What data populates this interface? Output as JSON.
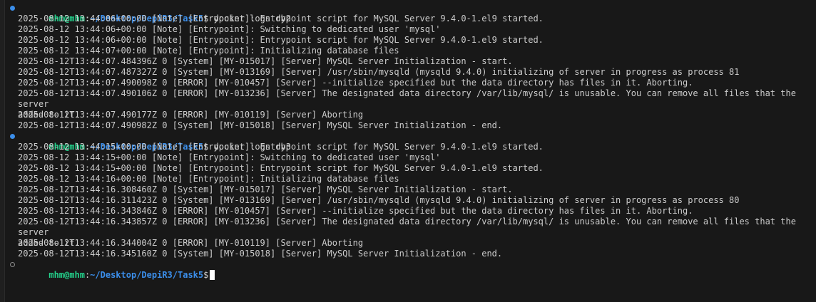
{
  "prompt": {
    "user": "mhm@mhm",
    "sep": ":",
    "path": "~/Desktop/DepiR3/Task5",
    "symbol": "$"
  },
  "blocks": [
    {
      "command": " docker logs db2",
      "lines": [
        "2025-08-12 13:44:06+00:00 [Note] [Entrypoint]: Entrypoint script for MySQL Server 9.4.0-1.el9 started.",
        "2025-08-12 13:44:06+00:00 [Note] [Entrypoint]: Switching to dedicated user 'mysql'",
        "2025-08-12 13:44:06+00:00 [Note] [Entrypoint]: Entrypoint script for MySQL Server 9.4.0-1.el9 started.",
        "2025-08-12 13:44:07+00:00 [Note] [Entrypoint]: Initializing database files",
        "2025-08-12T13:44:07.484396Z 0 [System] [MY-015017] [Server] MySQL Server Initialization - start.",
        "2025-08-12T13:44:07.487327Z 0 [System] [MY-013169] [Server] /usr/sbin/mysqld (mysqld 9.4.0) initializing of server in progress as process 81",
        "2025-08-12T13:44:07.490098Z 0 [ERROR] [MY-010457] [Server] --initialize specified but the data directory has files in it. Aborting.",
        "2025-08-12T13:44:07.490106Z 0 [ERROR] [MY-013236] [Server] The designated data directory /var/lib/mysql/ is unusable. You can remove all files that the server\nadded to it.",
        "2025-08-12T13:44:07.490177Z 0 [ERROR] [MY-010119] [Server] Aborting",
        "2025-08-12T13:44:07.490982Z 0 [System] [MY-015018] [Server] MySQL Server Initialization - end."
      ]
    },
    {
      "command": " docker logs db3",
      "lines": [
        "2025-08-12 13:44:15+00:00 [Note] [Entrypoint]: Entrypoint script for MySQL Server 9.4.0-1.el9 started.",
        "2025-08-12 13:44:15+00:00 [Note] [Entrypoint]: Switching to dedicated user 'mysql'",
        "2025-08-12 13:44:15+00:00 [Note] [Entrypoint]: Entrypoint script for MySQL Server 9.4.0-1.el9 started.",
        "2025-08-12 13:44:16+00:00 [Note] [Entrypoint]: Initializing database files",
        "2025-08-12T13:44:16.308460Z 0 [System] [MY-015017] [Server] MySQL Server Initialization - start.",
        "2025-08-12T13:44:16.311423Z 0 [System] [MY-013169] [Server] /usr/sbin/mysqld (mysqld 9.4.0) initializing of server in progress as process 80",
        "2025-08-12T13:44:16.343846Z 0 [ERROR] [MY-010457] [Server] --initialize specified but the data directory has files in it. Aborting.",
        "2025-08-12T13:44:16.343857Z 0 [ERROR] [MY-013236] [Server] The designated data directory /var/lib/mysql/ is unusable. You can remove all files that the server\nadded to it.",
        "2025-08-12T13:44:16.344004Z 0 [ERROR] [MY-010119] [Server] Aborting",
        "2025-08-12T13:44:16.345160Z 0 [System] [MY-015018] [Server] MySQL Server Initialization - end."
      ]
    }
  ],
  "active_prompt": {
    "input": ""
  },
  "colors": {
    "background": "#181818",
    "text": "#cccccc",
    "user": "#23d18b",
    "path": "#3b8eea",
    "decoration_done": "#3b8eea",
    "decoration_pending": "#8a8a8a",
    "cursor": "#ffffff"
  },
  "icons": {
    "completed_command": "command-success-decoration-icon",
    "pending_command": "command-pending-decoration-icon"
  }
}
